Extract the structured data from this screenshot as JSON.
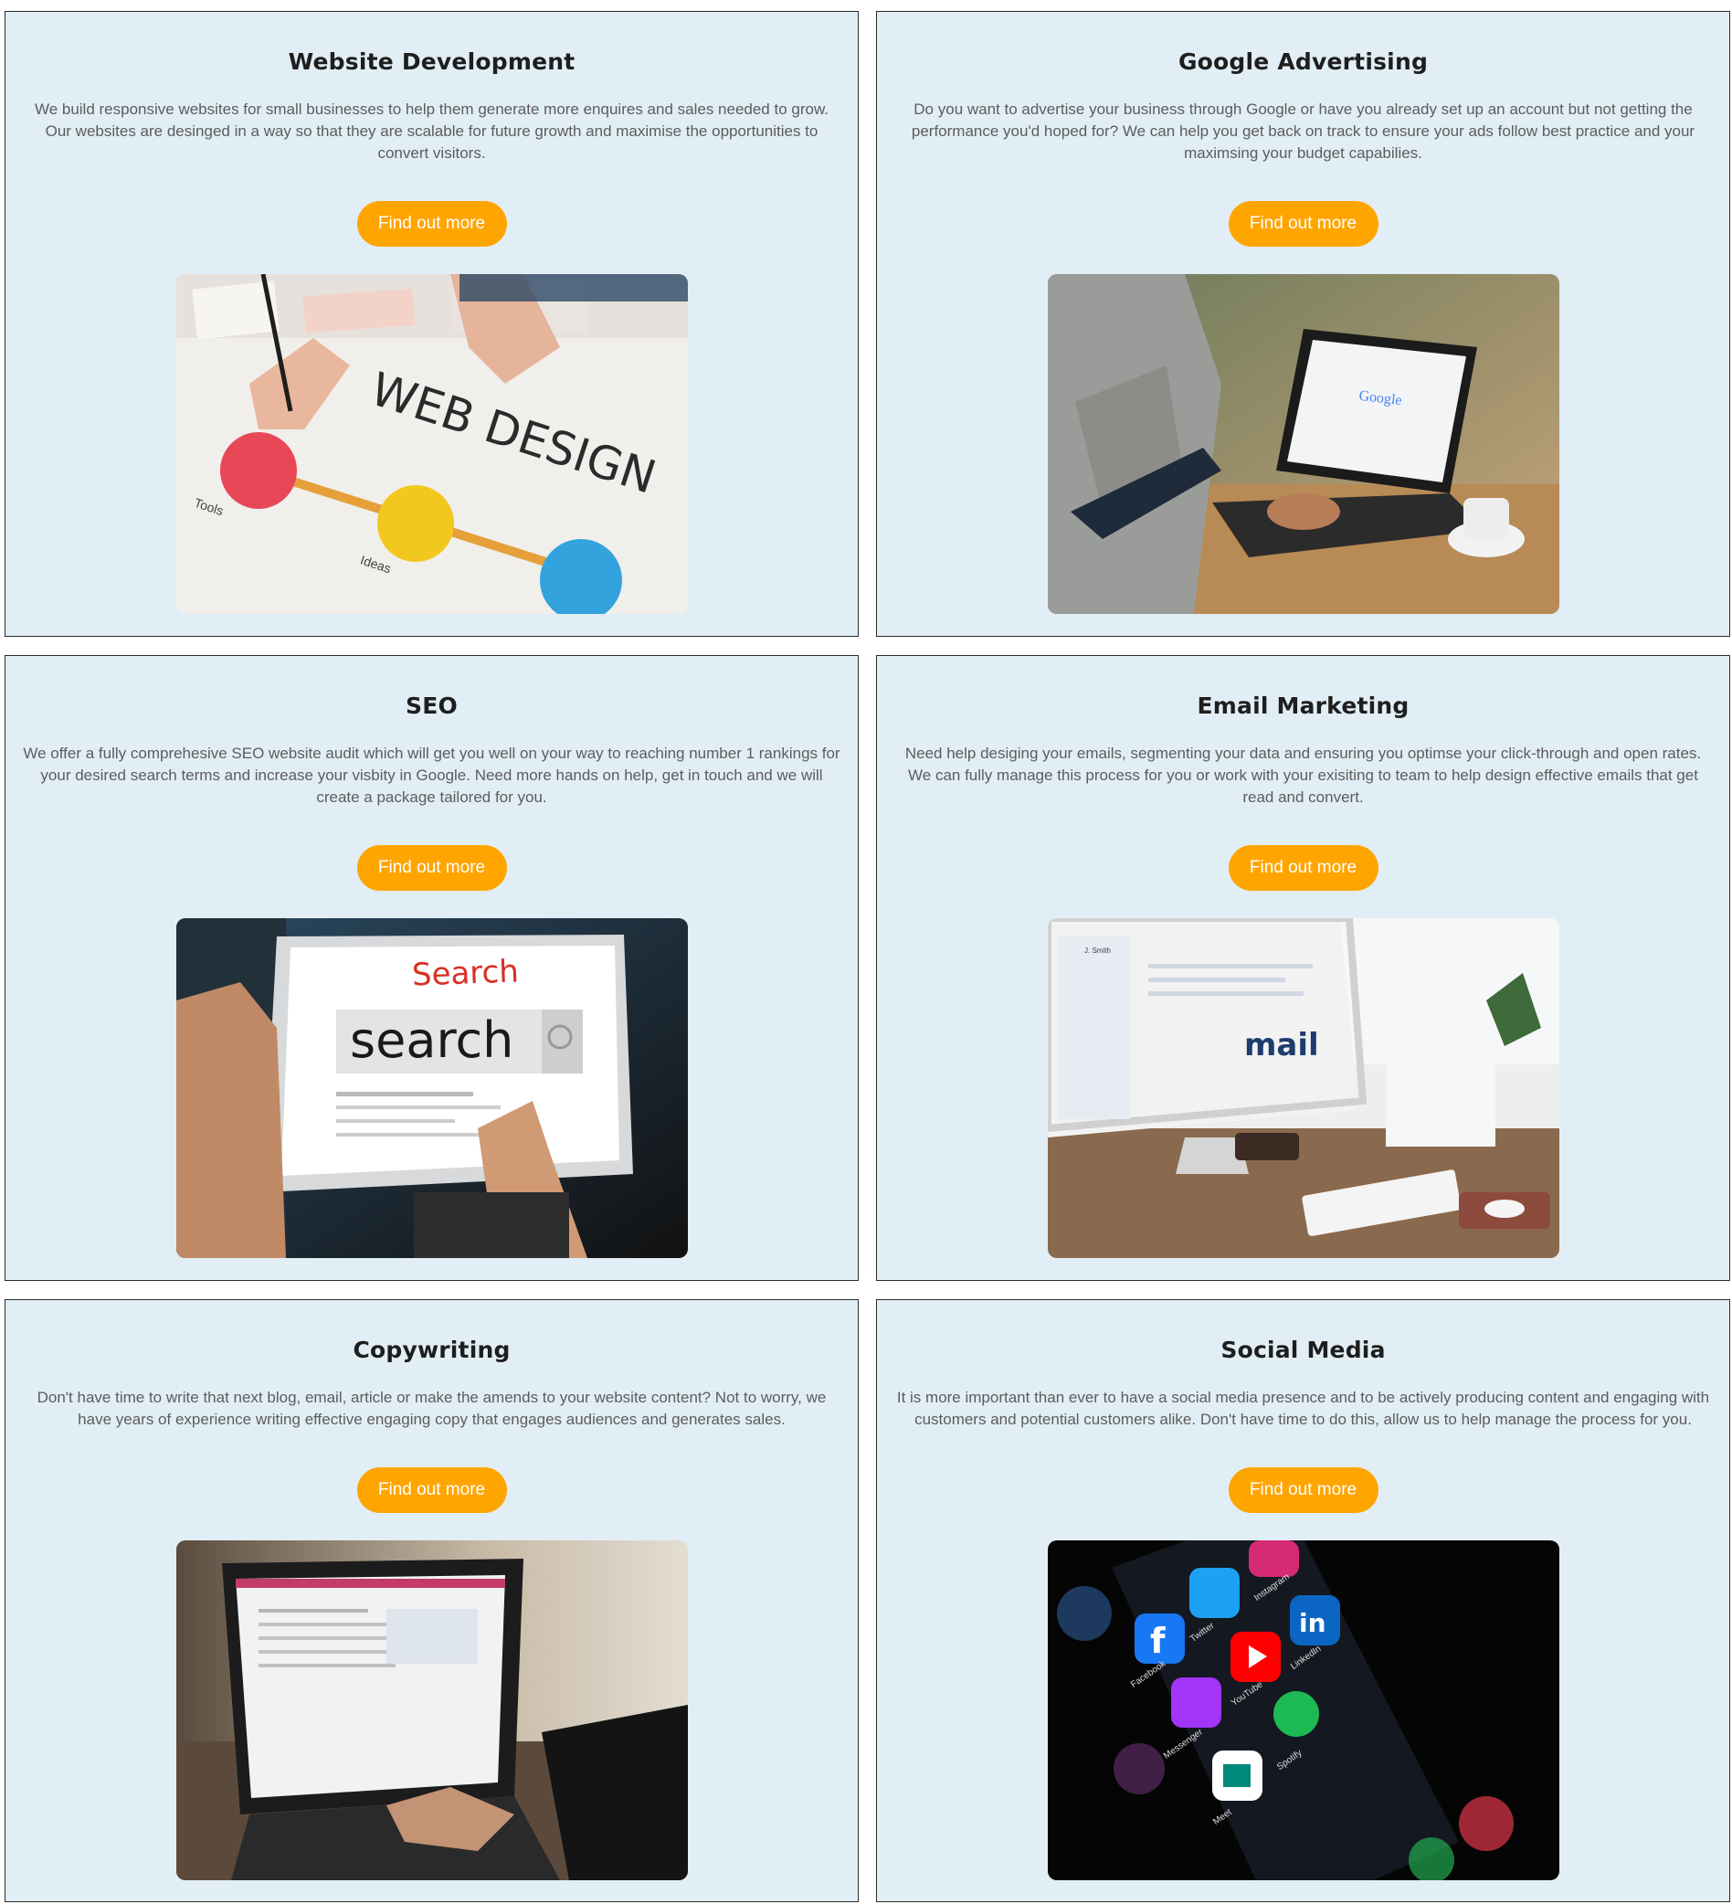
{
  "cta_label": "Find out more",
  "colors": {
    "card_background": "#e2eef5",
    "card_border": "#2a2a2a",
    "button": "#ffa500",
    "title": "#1e1e1e",
    "body_text": "#5c5c5c"
  },
  "services": [
    {
      "title": "Website Development",
      "description": "We build responsive websites for small businesses to help them generate more enquires and sales needed to grow. Our websites are desinged in a way so that they are scalable for future growth and maximise the opportunities to convert visitors.",
      "image": {
        "subject": "web-design-photo",
        "texts": {
          "headline": "WEB DESIGN",
          "label1": "Tools",
          "label2": "Ideas"
        }
      }
    },
    {
      "title": "Google Advertising",
      "description": "Do you want to advertise your business through Google or have you already set up an account but not getting the performance you'd hoped for? We can help you get back on track to ensure your ads follow best practice and your maximsing your budget capabilies.",
      "image": {
        "subject": "laptop-google-photo",
        "texts": {
          "logo": "Google"
        }
      }
    },
    {
      "title": "SEO",
      "description": "We offer a fully comprehesive SEO website audit which will get you well on your way to reaching number 1 rankings for your desired search terms and increase your visbity in Google. Need more hands on help, get in touch and we will create a package tailored for you.",
      "image": {
        "subject": "tablet-search-photo",
        "texts": {
          "logo": "Search",
          "query": "search"
        }
      }
    },
    {
      "title": "Email Marketing",
      "description": "Need help desiging your emails, segmenting your data and ensuring you optimse your click-through and open rates. We can fully manage this process for you or work with your exisiting to team to help design effective emails that get read and convert.",
      "image": {
        "subject": "desktop-mail-photo",
        "texts": {
          "word": "mail",
          "sender": "J. Smith"
        }
      }
    },
    {
      "title": "Copywriting",
      "description": "Don't have time to write that next blog, email, article or make the amends to your website content? Not to worry, we have years of experience writing effective engaging copy that engages audiences and generates sales.",
      "image": {
        "subject": "laptop-typing-photo",
        "texts": {}
      }
    },
    {
      "title": "Social Media",
      "description": "It is more important than ever to have a social media presence and to be actively producing content and engaging with customers and potential customers alike. Don't have time to do this, allow us to help manage the process for you.",
      "image": {
        "subject": "phone-social-apps-photo",
        "texts": {
          "facebook": "Facebook",
          "twitter": "Twitter",
          "instagram": "Instagram",
          "messenger": "Messenger",
          "youtube": "YouTube",
          "linkedin": "LinkedIn",
          "meet": "Meet",
          "spotify": "Spotify"
        }
      }
    }
  ]
}
